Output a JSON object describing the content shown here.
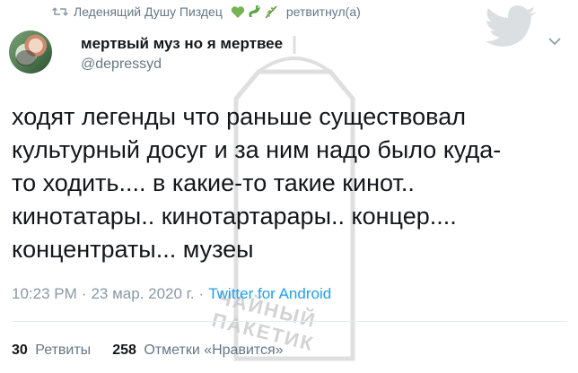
{
  "retweet": {
    "user": "Леденящий Душу Пиздец",
    "emoji_icons": [
      "green-heart-emoji",
      "green-snake-emoji",
      "herb-emoji"
    ],
    "action": "ретвитнул(а)"
  },
  "author": {
    "name": "мертвый муз но я мертвее",
    "handle": "@depressyd"
  },
  "tweet": {
    "text": "ходят легенды что раньше существовал\nкультурный досуг и за ним надо было куда-\nто ходить.... в какие-то такие кинот..\nкинотатары.. кинотартарары.. концер....\nконцентраты... музеы"
  },
  "meta": {
    "time": "10:23 PM",
    "sep1": "·",
    "date": "23 мар. 2020 г.",
    "sep2": "·",
    "source": "Twitter for Android"
  },
  "stats": {
    "retweets_count": "30",
    "retweets_label": "Ретвиты",
    "likes_count": "258",
    "likes_label": "Отметки «Нравится»"
  },
  "watermark": {
    "line1": "ЧАЙНЫЙ",
    "line2": "ПАКЕТИК"
  },
  "colors": {
    "accent": "#1da1f2",
    "muted": "#657786",
    "text": "#14171a",
    "heart": "#77b255"
  }
}
